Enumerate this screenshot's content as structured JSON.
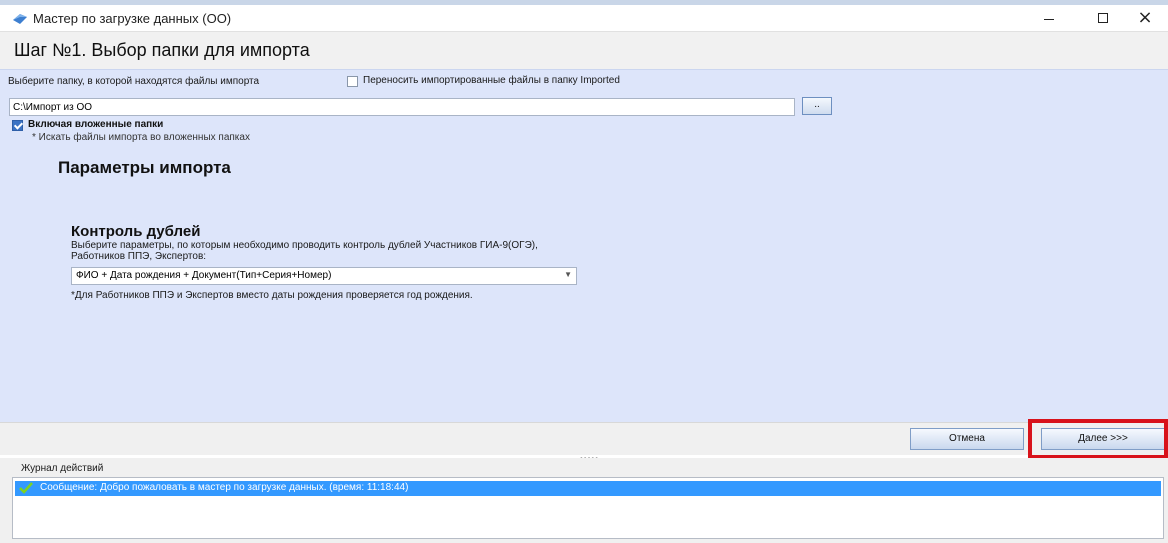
{
  "window": {
    "title": "Мастер по загрузке данных (ОО)"
  },
  "step": {
    "title": "Шаг №1.  Выбор папки для импорта"
  },
  "folder": {
    "label": "Выберите папку, в которой находятся файлы импорта",
    "move_checkbox_label": "Переносить импортированные файлы в папку Imported",
    "move_checked": false,
    "path_value": "C:\\Импорт из ОО",
    "browse_label": "..",
    "include_subfolders_label": "Включая вложенные папки",
    "include_subfolders_checked": true,
    "include_subfolders_hint": "* Искать файлы импорта во вложенных папках"
  },
  "params": {
    "title": "Параметры импорта",
    "duplicates_title": "Контроль дублей",
    "duplicates_desc": "Выберите параметры, по которым необходимо проводить контроль дублей Участников ГИА-9(ОГЭ), Работников ППЭ, Экспертов:",
    "duplicates_selected": "ФИО + Дата рождения + Документ(Тип+Серия+Номер)",
    "duplicates_note": "*Для Работников ППЭ и Экспертов вместо даты рождения проверяется год рождения."
  },
  "buttons": {
    "cancel": "Отмена",
    "next": "Далее >>>"
  },
  "log": {
    "label": "Журнал действий",
    "entries": [
      {
        "text": "Сообщение: Добро пожаловать в мастер по загрузке данных. (время: 11:18:44)"
      }
    ]
  },
  "colors": {
    "content_bg": "#dde5fa",
    "highlight": "#d8121a",
    "log_selected": "#3399ff"
  }
}
